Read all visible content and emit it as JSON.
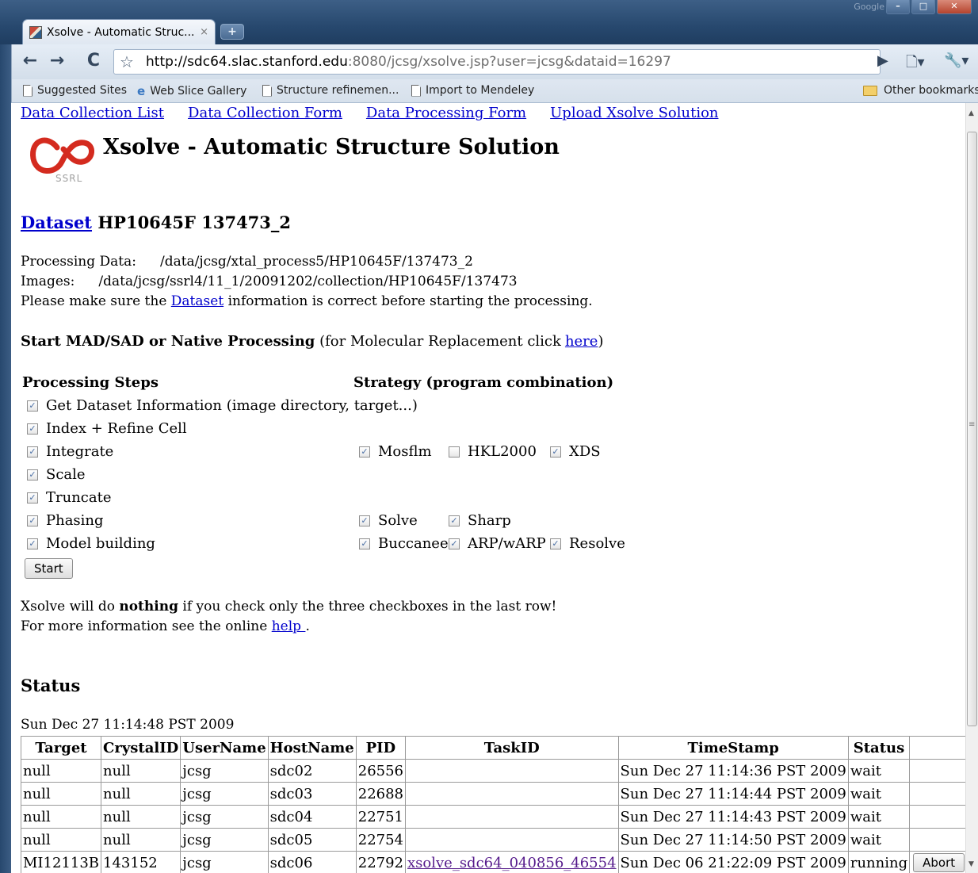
{
  "browser": {
    "tab_title": "Xsolve - Automatic Struc...",
    "tab_close": "×",
    "new_tab": "+",
    "url_host": "http://sdc64.slac.stanford.edu",
    "url_rest": ":8080/jcsg/xsolve.jsp?user=jcsg&dataid=16297",
    "ghost_text": "Google",
    "bookmarks": [
      {
        "label": "Suggested Sites",
        "icon": "page-icon"
      },
      {
        "label": "Web Slice Gallery",
        "icon": "ie-icon"
      },
      {
        "label": "Structure refinemen...",
        "icon": "page-icon"
      },
      {
        "label": "Import to Mendeley",
        "icon": "page-icon"
      }
    ],
    "other_bookmarks": "Other bookmarks"
  },
  "nav": {
    "data_collection_list": "Data Collection List",
    "data_collection_form": "Data Collection Form",
    "data_processing_form": "Data Processing Form",
    "upload_solution": "Upload Xsolve Solution"
  },
  "header": {
    "title": "Xsolve - Automatic Structure Solution",
    "logo_text": "SSRL"
  },
  "dataset": {
    "link": "Dataset",
    "name": "HP10645F 137473_2",
    "processing_label": "Processing Data:",
    "processing_path": "/data/jcsg/xtal_process5/HP10645F/137473_2",
    "images_label": "Images:",
    "images_path": "/data/jcsg/ssrl4/11_1/20091202/collection/HP10645F/137473",
    "notice_pre": "Please make sure the",
    "notice_link": "Dataset",
    "notice_post": "information is correct before starting the processing."
  },
  "processing": {
    "heading": "Start MAD/SAD or Native Processing",
    "mr_note_pre": "(for Molecular Replacement click",
    "mr_link": "here",
    "mr_note_post": ")",
    "steps_heading": "Processing Steps",
    "strategy_heading": "Strategy (program combination)",
    "steps": [
      {
        "label": "Get Dataset Information (image directory, target...)",
        "checked": true
      },
      {
        "label": "Index + Refine Cell",
        "checked": true
      },
      {
        "label": "Integrate",
        "checked": true
      },
      {
        "label": "Scale",
        "checked": true
      },
      {
        "label": "Truncate",
        "checked": true
      },
      {
        "label": "Phasing",
        "checked": true
      },
      {
        "label": "Model building",
        "checked": true
      }
    ],
    "integrate_programs": [
      {
        "label": "Mosflm",
        "checked": true
      },
      {
        "label": "HKL2000",
        "checked": false
      },
      {
        "label": "XDS",
        "checked": true
      }
    ],
    "phasing_programs": [
      {
        "label": "Solve",
        "checked": true
      },
      {
        "label": "Sharp",
        "checked": true
      }
    ],
    "model_programs": [
      {
        "label": "Buccaneer",
        "checked": true
      },
      {
        "label": "ARP/wARP",
        "checked": true
      },
      {
        "label": "Resolve",
        "checked": true
      }
    ],
    "start_button": "Start",
    "warning_pre": "Xsolve will do",
    "warning_bold": "nothing",
    "warning_post": "if you check only the three checkboxes in the last row!",
    "info_pre": "For more information see the online",
    "info_link": "help ",
    "info_post": "."
  },
  "status": {
    "heading": "Status",
    "timestamp": "Sun Dec 27 11:14:48 PST 2009",
    "columns": [
      "Target",
      "CrystalID",
      "UserName",
      "HostName",
      "PID",
      "TaskID",
      "TimeStamp",
      "Status",
      ""
    ],
    "rows": [
      {
        "target": "null",
        "crystal": "null",
        "user": "jcsg",
        "host": "sdc02",
        "pid": "26556",
        "task": "",
        "time": "Sun Dec 27 11:14:36 PST 2009",
        "status": "wait",
        "action": ""
      },
      {
        "target": "null",
        "crystal": "null",
        "user": "jcsg",
        "host": "sdc03",
        "pid": "22688",
        "task": "",
        "time": "Sun Dec 27 11:14:44 PST 2009",
        "status": "wait",
        "action": ""
      },
      {
        "target": "null",
        "crystal": "null",
        "user": "jcsg",
        "host": "sdc04",
        "pid": "22751",
        "task": "",
        "time": "Sun Dec 27 11:14:43 PST 2009",
        "status": "wait",
        "action": ""
      },
      {
        "target": "null",
        "crystal": "null",
        "user": "jcsg",
        "host": "sdc05",
        "pid": "22754",
        "task": "",
        "time": "Sun Dec 27 11:14:50 PST 2009",
        "status": "wait",
        "action": ""
      },
      {
        "target": "MI12113B",
        "crystal": "143152",
        "user": "jcsg",
        "host": "sdc06",
        "pid": "22792",
        "task": "xsolve_sdc64_040856_46554",
        "time": "Sun Dec 06 21:22:09 PST 2009",
        "status": "running",
        "action": "Abort"
      }
    ]
  }
}
